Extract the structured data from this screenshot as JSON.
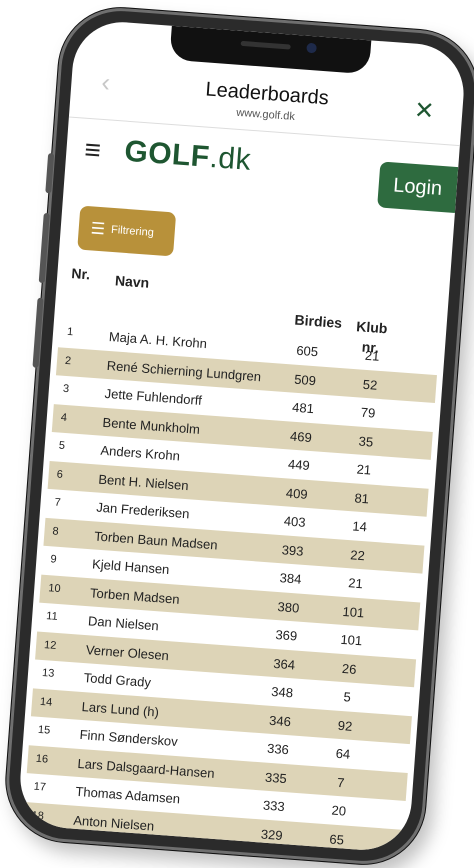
{
  "nav": {
    "back_label": "‹",
    "title": "Leaderboards",
    "url": "www.golf.dk",
    "close_label": "✕"
  },
  "site": {
    "logo_main": "GOLF",
    "logo_suffix": ".dk",
    "menu_icon": "≡",
    "login_label": "Login"
  },
  "filter": {
    "label": "Filtrering",
    "icon": "sliders-icon"
  },
  "table": {
    "headers": {
      "nr": "Nr.",
      "navn": "Navn",
      "birdies": "Birdies",
      "klub_line1": "Klub",
      "klub_line2": "nr."
    },
    "rows": [
      {
        "nr": "1",
        "name": "Maja A. H. Krohn",
        "birdies": "605",
        "klub": "21"
      },
      {
        "nr": "2",
        "name": "René Schierning Lundgren",
        "birdies": "509",
        "klub": "52"
      },
      {
        "nr": "3",
        "name": "Jette Fuhlendorff",
        "birdies": "481",
        "klub": "79"
      },
      {
        "nr": "4",
        "name": "Bente Munkholm",
        "birdies": "469",
        "klub": "35"
      },
      {
        "nr": "5",
        "name": "Anders Krohn",
        "birdies": "449",
        "klub": "21"
      },
      {
        "nr": "6",
        "name": "Bent H. Nielsen",
        "birdies": "409",
        "klub": "81"
      },
      {
        "nr": "7",
        "name": "Jan Frederiksen",
        "birdies": "403",
        "klub": "14"
      },
      {
        "nr": "8",
        "name": "Torben Baun Madsen",
        "birdies": "393",
        "klub": "22"
      },
      {
        "nr": "9",
        "name": "Kjeld Hansen",
        "birdies": "384",
        "klub": "21"
      },
      {
        "nr": "10",
        "name": "Torben Madsen",
        "birdies": "380",
        "klub": "101"
      },
      {
        "nr": "11",
        "name": "Dan Nielsen",
        "birdies": "369",
        "klub": "101"
      },
      {
        "nr": "12",
        "name": "Verner Olesen",
        "birdies": "364",
        "klub": "26"
      },
      {
        "nr": "13",
        "name": "Todd Grady",
        "birdies": "348",
        "klub": "5"
      },
      {
        "nr": "14",
        "name": "Lars Lund (h)",
        "birdies": "346",
        "klub": "92"
      },
      {
        "nr": "15",
        "name": "Finn Sønderskov",
        "birdies": "336",
        "klub": "64"
      },
      {
        "nr": "16",
        "name": "Lars Dalsgaard-Hansen",
        "birdies": "335",
        "klub": "7"
      },
      {
        "nr": "17",
        "name": "Thomas Adamsen",
        "birdies": "333",
        "klub": "20"
      },
      {
        "nr": "18",
        "name": "Anton Nielsen",
        "birdies": "329",
        "klub": "65"
      }
    ]
  },
  "colors": {
    "brand_green": "#1e5631",
    "login_green": "#2e6b3f",
    "filter_gold": "#b8913a",
    "row_alt": "#ddd4b7"
  }
}
